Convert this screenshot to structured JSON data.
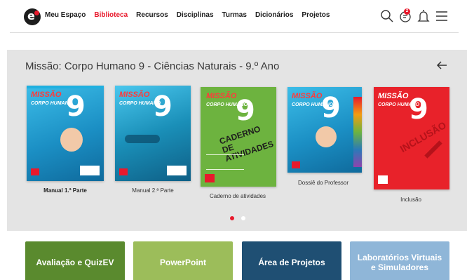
{
  "nav": {
    "items": [
      {
        "label": "Meu Espaço",
        "active": false
      },
      {
        "label": "Biblioteca",
        "active": true
      },
      {
        "label": "Recursos",
        "active": false
      },
      {
        "label": "Disciplinas",
        "active": false
      },
      {
        "label": "Turmas",
        "active": false
      },
      {
        "label": "Dicionários",
        "active": false
      },
      {
        "label": "Projetos",
        "active": false
      }
    ],
    "icons": [
      "search-icon",
      "notifications-chat-icon",
      "bell-icon",
      "menu-icon"
    ],
    "badge_count": "2",
    "accent_color": "#e8192c"
  },
  "library": {
    "title": "Missão: Corpo Humano 9 - Ciências Naturais - 9.º Ano",
    "books": [
      {
        "label": "Manual 1.ª Parte",
        "cover_color": "#2aa7d8"
      },
      {
        "label": "Manual 2.ª Parte",
        "cover_color": "#1a8fb8"
      },
      {
        "label": "Caderno de atividades",
        "cover_color": "#6db33f"
      },
      {
        "label": "Dossiê do Professor",
        "cover_color": "#2aa7d8"
      },
      {
        "label": "Inclusão",
        "cover_color": "#e8222a"
      }
    ],
    "cover_brand": "MISSÃO",
    "cover_sub": "CORPO HUMANO",
    "cover_number": "9",
    "activities_cover_text": "CADERNO DE ATIVIDADES",
    "inclusion_cover_text": "INCLUSÃO",
    "pagination": {
      "pages": 2,
      "current": 1
    }
  },
  "tiles": [
    {
      "label": "Avaliação e QuizEV",
      "color": "#5a8a2e"
    },
    {
      "label": "PowerPoint",
      "color": "#9cbd5a"
    },
    {
      "label": "Área de Projetos",
      "color": "#1f4f73"
    },
    {
      "label": "Laboratórios Virtuais e Simuladores",
      "color": "#8fb6d8"
    }
  ]
}
